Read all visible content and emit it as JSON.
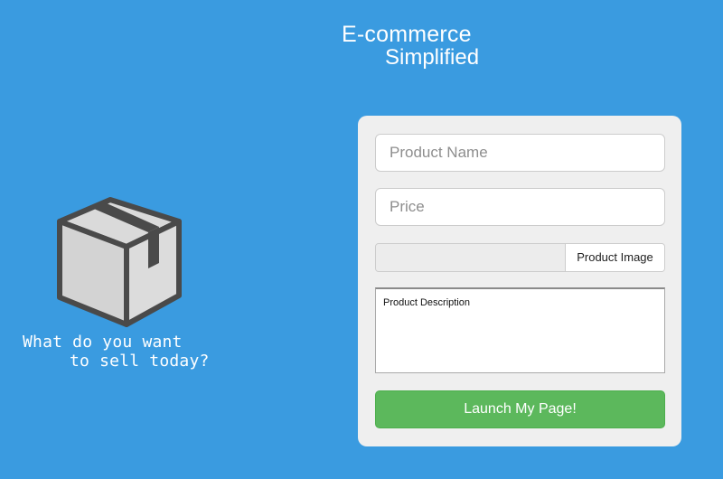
{
  "header": {
    "title_line1": "E-commerce",
    "title_line2": "Simplified"
  },
  "hero": {
    "icon": "package-box-icon",
    "tagline_line1": "What do you want",
    "tagline_line2": "to sell today?"
  },
  "form": {
    "product_name": {
      "placeholder": "Product Name",
      "value": ""
    },
    "price": {
      "placeholder": "Price",
      "value": ""
    },
    "product_image": {
      "button_label": "Product Image",
      "selected_file": ""
    },
    "product_description": {
      "placeholder": "Product Description",
      "value": ""
    },
    "submit_label": "Launch My Page!"
  },
  "colors": {
    "background": "#3a9be0",
    "card": "#efefef",
    "submit": "#5cb85c",
    "box_fill": "#d9d9d9",
    "box_stroke": "#4a4a4a"
  }
}
